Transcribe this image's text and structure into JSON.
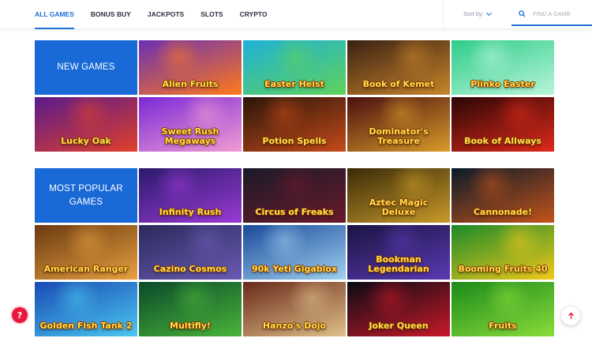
{
  "nav": {
    "tabs": [
      {
        "label": "ALL GAMES",
        "active": true
      },
      {
        "label": "BONUS BUY",
        "active": false
      },
      {
        "label": "JACKPOTS",
        "active": false
      },
      {
        "label": "SLOTS",
        "active": false
      },
      {
        "label": "CRYPTO",
        "active": false
      }
    ],
    "sort_label": "Sort by:",
    "search_placeholder": "FIND A GAME"
  },
  "sections": [
    {
      "title": "NEW GAMES",
      "games": [
        {
          "name": "Alien Fruits",
          "bg": [
            "#6a2fb5",
            "#ff7a1a"
          ]
        },
        {
          "name": "Easter Heist",
          "bg": [
            "#1fb0d8",
            "#5fd35a"
          ]
        },
        {
          "name": "Book of Kemet",
          "bg": [
            "#3a2113",
            "#c8852a"
          ]
        },
        {
          "name": "Plinko Easter",
          "bg": [
            "#2ecc8a",
            "#b9f5d8"
          ]
        },
        {
          "name": "Lucky Oak",
          "bg": [
            "#5a1a8c",
            "#e0402a"
          ]
        },
        {
          "name": "Sweet Rush Megaways",
          "bg": [
            "#7a2ad6",
            "#f29bd4"
          ]
        },
        {
          "name": "Potion Spells",
          "bg": [
            "#2a1608",
            "#c44a1a"
          ]
        },
        {
          "name": "Dominator's Treasure",
          "bg": [
            "#4a1010",
            "#d99a2a"
          ]
        },
        {
          "name": "Book of Allways",
          "bg": [
            "#2a0606",
            "#e02a1a"
          ]
        }
      ]
    },
    {
      "title": "MOST POPULAR GAMES",
      "games": [
        {
          "name": "Infinity Rush",
          "bg": [
            "#2a1a6a",
            "#9a3ad6"
          ]
        },
        {
          "name": "Circus of Freaks",
          "bg": [
            "#1a1a2a",
            "#6a1a2a"
          ]
        },
        {
          "name": "Aztec Magic Deluxe",
          "bg": [
            "#3a2a08",
            "#c89a2a"
          ]
        },
        {
          "name": "Cannonade!",
          "bg": [
            "#0a1a2a",
            "#c4541a"
          ]
        },
        {
          "name": "American Ranger",
          "bg": [
            "#6a3a10",
            "#e8a040"
          ]
        },
        {
          "name": "Cazino Cosmos",
          "bg": [
            "#2a2a5a",
            "#6a5ab4"
          ]
        },
        {
          "name": "90k Yeti Gigablox",
          "bg": [
            "#1a4a9a",
            "#a0d0f0"
          ]
        },
        {
          "name": "Bookman Legendarian",
          "bg": [
            "#1a1440",
            "#5a3ab4"
          ]
        },
        {
          "name": "Booming Fruits 40",
          "bg": [
            "#1a8a2a",
            "#f2c81a"
          ]
        },
        {
          "name": "Golden Fish Tank 2",
          "bg": [
            "#1a4ab4",
            "#4ac8f0"
          ]
        },
        {
          "name": "Multifly!",
          "bg": [
            "#0a4a2a",
            "#4ab43a"
          ]
        },
        {
          "name": "Hanzo's Dojo",
          "bg": [
            "#6a2a1a",
            "#e0c08a"
          ]
        },
        {
          "name": "Joker Queen",
          "bg": [
            "#0a0a14",
            "#c81a2a"
          ]
        },
        {
          "name": "Fruits",
          "bg": [
            "#1a8a1a",
            "#8adc3a"
          ]
        }
      ]
    }
  ],
  "colors": {
    "accent": "#1a6fd9",
    "header_tile": "#1969d6",
    "help": "#e9163f"
  },
  "icons": {
    "search": "search-icon",
    "help": "help-icon",
    "scroll_top": "arrow-up-icon"
  }
}
